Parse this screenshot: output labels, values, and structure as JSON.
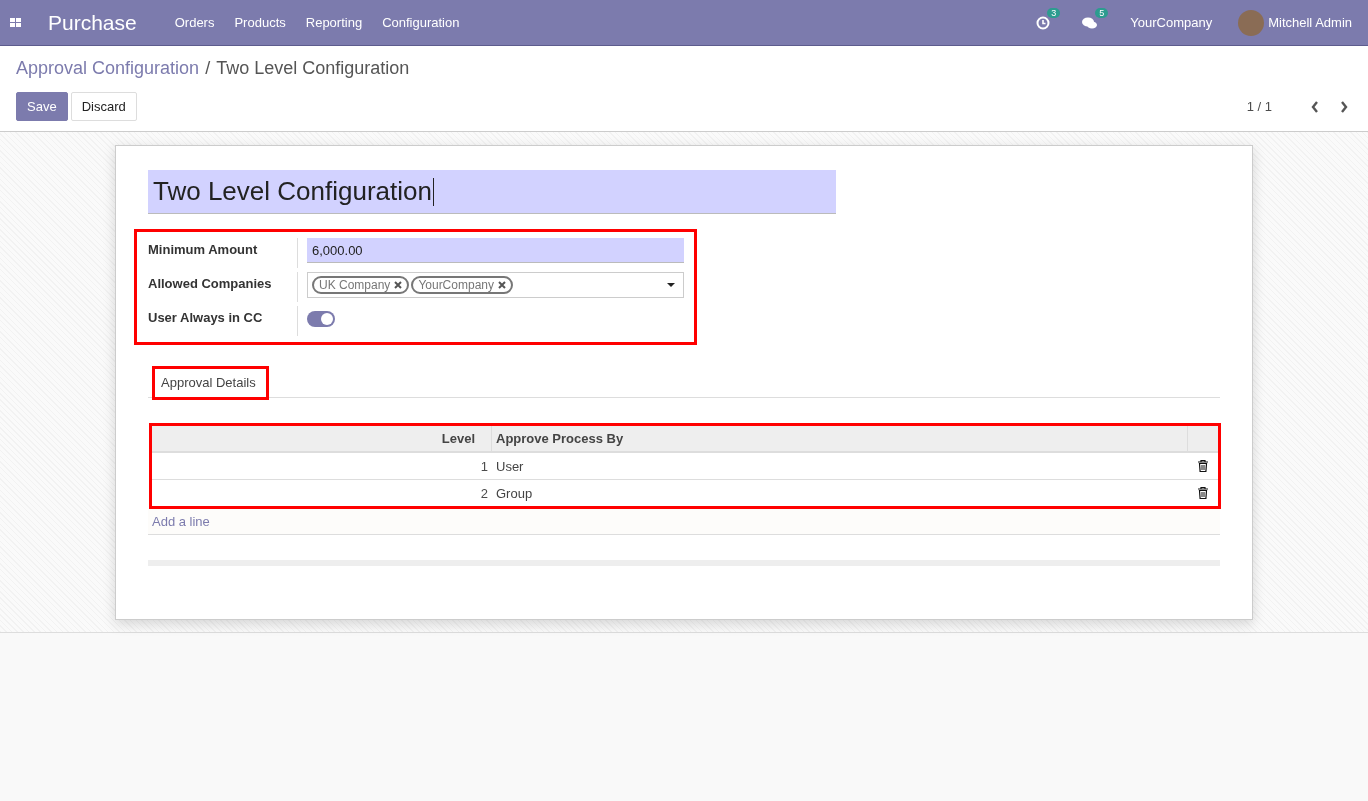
{
  "navbar": {
    "app_name": "Purchase",
    "menu": [
      "Orders",
      "Products",
      "Reporting",
      "Configuration"
    ],
    "activity_count": "3",
    "message_count": "5",
    "company": "YourCompany",
    "user": "Mitchell Admin"
  },
  "breadcrumb": {
    "parent": "Approval Configuration",
    "separator": "/",
    "current": "Two Level Configuration"
  },
  "buttons": [
    "Save",
    "Discard"
  ],
  "pager": {
    "value": "1 / 1"
  },
  "form": {
    "name": "Two Level Configuration",
    "fields": [
      {
        "kind": "input",
        "label": "Minimum Amount",
        "value": "6,000.00"
      },
      {
        "kind": "tags",
        "label": "Allowed Companies",
        "tags": [
          "UK Company",
          "YourCompany"
        ]
      },
      {
        "kind": "toggle",
        "label": "User Always in CC",
        "on": true
      }
    ],
    "tabs": [
      {
        "label": "Approval Details",
        "selected": true
      }
    ],
    "table": {
      "columns": [
        "Level",
        "Approve Process By"
      ],
      "rows": [
        [
          "1",
          "User"
        ],
        [
          "2",
          "Group"
        ]
      ],
      "add_line": "Add a line"
    }
  }
}
